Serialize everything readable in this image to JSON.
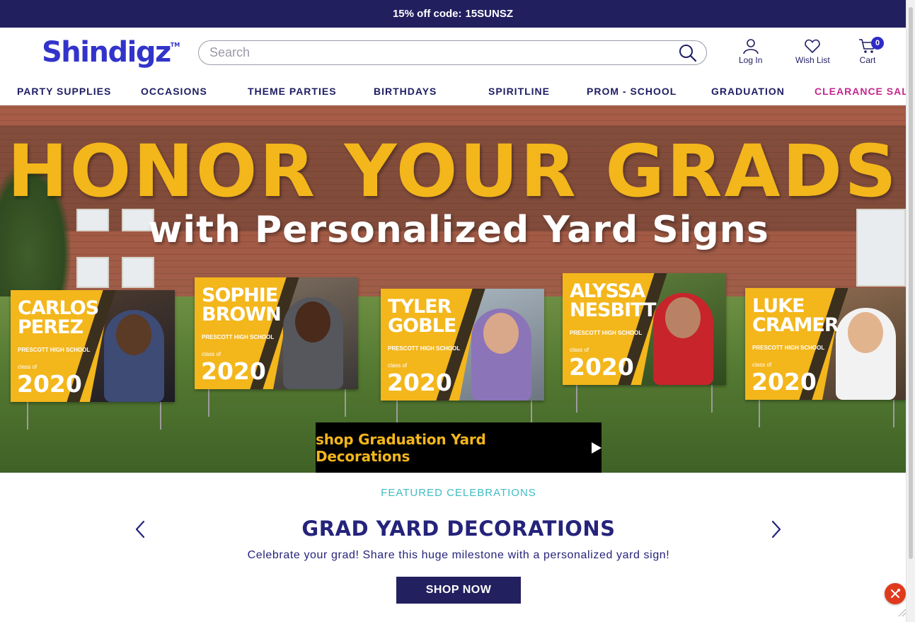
{
  "promo": {
    "text": "15% off code:",
    "code": "15SUNSZ"
  },
  "header": {
    "logo": "Shindigz",
    "logo_tm": "TM",
    "search_placeholder": "Search",
    "login_label": "Log In",
    "wishlist_label": "Wish List",
    "cart_label": "Cart",
    "cart_count": "0"
  },
  "nav": {
    "items": [
      "PARTY SUPPLIES",
      "OCCASIONS",
      "THEME PARTIES",
      "BIRTHDAYS",
      "SPIRITLINE",
      "PROM - SCHOOL",
      "GRADUATION",
      "CLEARANCE SALE"
    ]
  },
  "hero": {
    "headline1": "HONOR YOUR GRADS",
    "headline2": "with Personalized Yard Signs",
    "cta": "shop Graduation Yard Decorations",
    "signs": [
      {
        "name": "CARLOS PEREZ",
        "school": "PRESCOTT HIGH SCHOOL",
        "class_of": "class of",
        "year": "2020"
      },
      {
        "name": "SOPHIE BROWN",
        "school": "PRESCOTT HIGH SCHOOL",
        "class_of": "class of",
        "year": "2020"
      },
      {
        "name": "TYLER GOBLE",
        "school": "PRESCOTT HIGH SCHOOL",
        "class_of": "class of",
        "year": "2020"
      },
      {
        "name": "ALYSSA NESBITT",
        "school": "PRESCOTT HIGH SCHOOL",
        "class_of": "class of",
        "year": "2020"
      },
      {
        "name": "LUKE CRAMER",
        "school": "PRESCOTT HIGH SCHOOL",
        "class_of": "class of",
        "year": "2020"
      }
    ]
  },
  "featured": {
    "label": "FEATURED CELEBRATIONS",
    "title": "GRAD YARD DECORATIONS",
    "description": "Celebrate your grad! Share this huge milestone with a personalized yard sign!",
    "button": "SHOP NOW"
  },
  "icons": {
    "search": "search-icon",
    "user": "user-icon",
    "heart": "heart-icon",
    "cart": "cart-icon",
    "prev": "chevron-left-icon",
    "next": "chevron-right-icon",
    "fab": "utensils-icon"
  },
  "colors": {
    "brand_navy": "#221f5f",
    "brand_blue": "#3234c9",
    "gold": "#f3b61b",
    "sale_pink": "#c4278e",
    "teal": "#3fbcc4",
    "fab_red": "#e03a1d"
  }
}
